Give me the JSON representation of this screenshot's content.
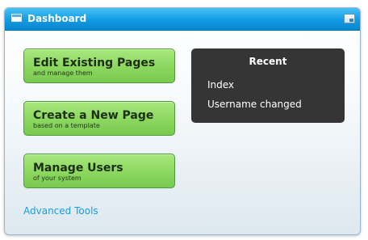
{
  "window": {
    "title": "Dashboard"
  },
  "actions": [
    {
      "title": "Edit Existing Pages",
      "subtitle": "and manage them"
    },
    {
      "title": "Create a New Page",
      "subtitle": "based on a template"
    },
    {
      "title": "Manage Users",
      "subtitle": "of your system"
    }
  ],
  "advanced_link": "Advanced Tools",
  "recent": {
    "heading": "Recent",
    "items": [
      "Index",
      "Username changed"
    ]
  },
  "colors": {
    "titlebar": "#129ae3",
    "button_green": "#8fda64",
    "panel_dark": "#353535",
    "link": "#1a9ed8"
  },
  "icons": {
    "window_icon": "window-icon",
    "maximize": "maximize-icon"
  }
}
